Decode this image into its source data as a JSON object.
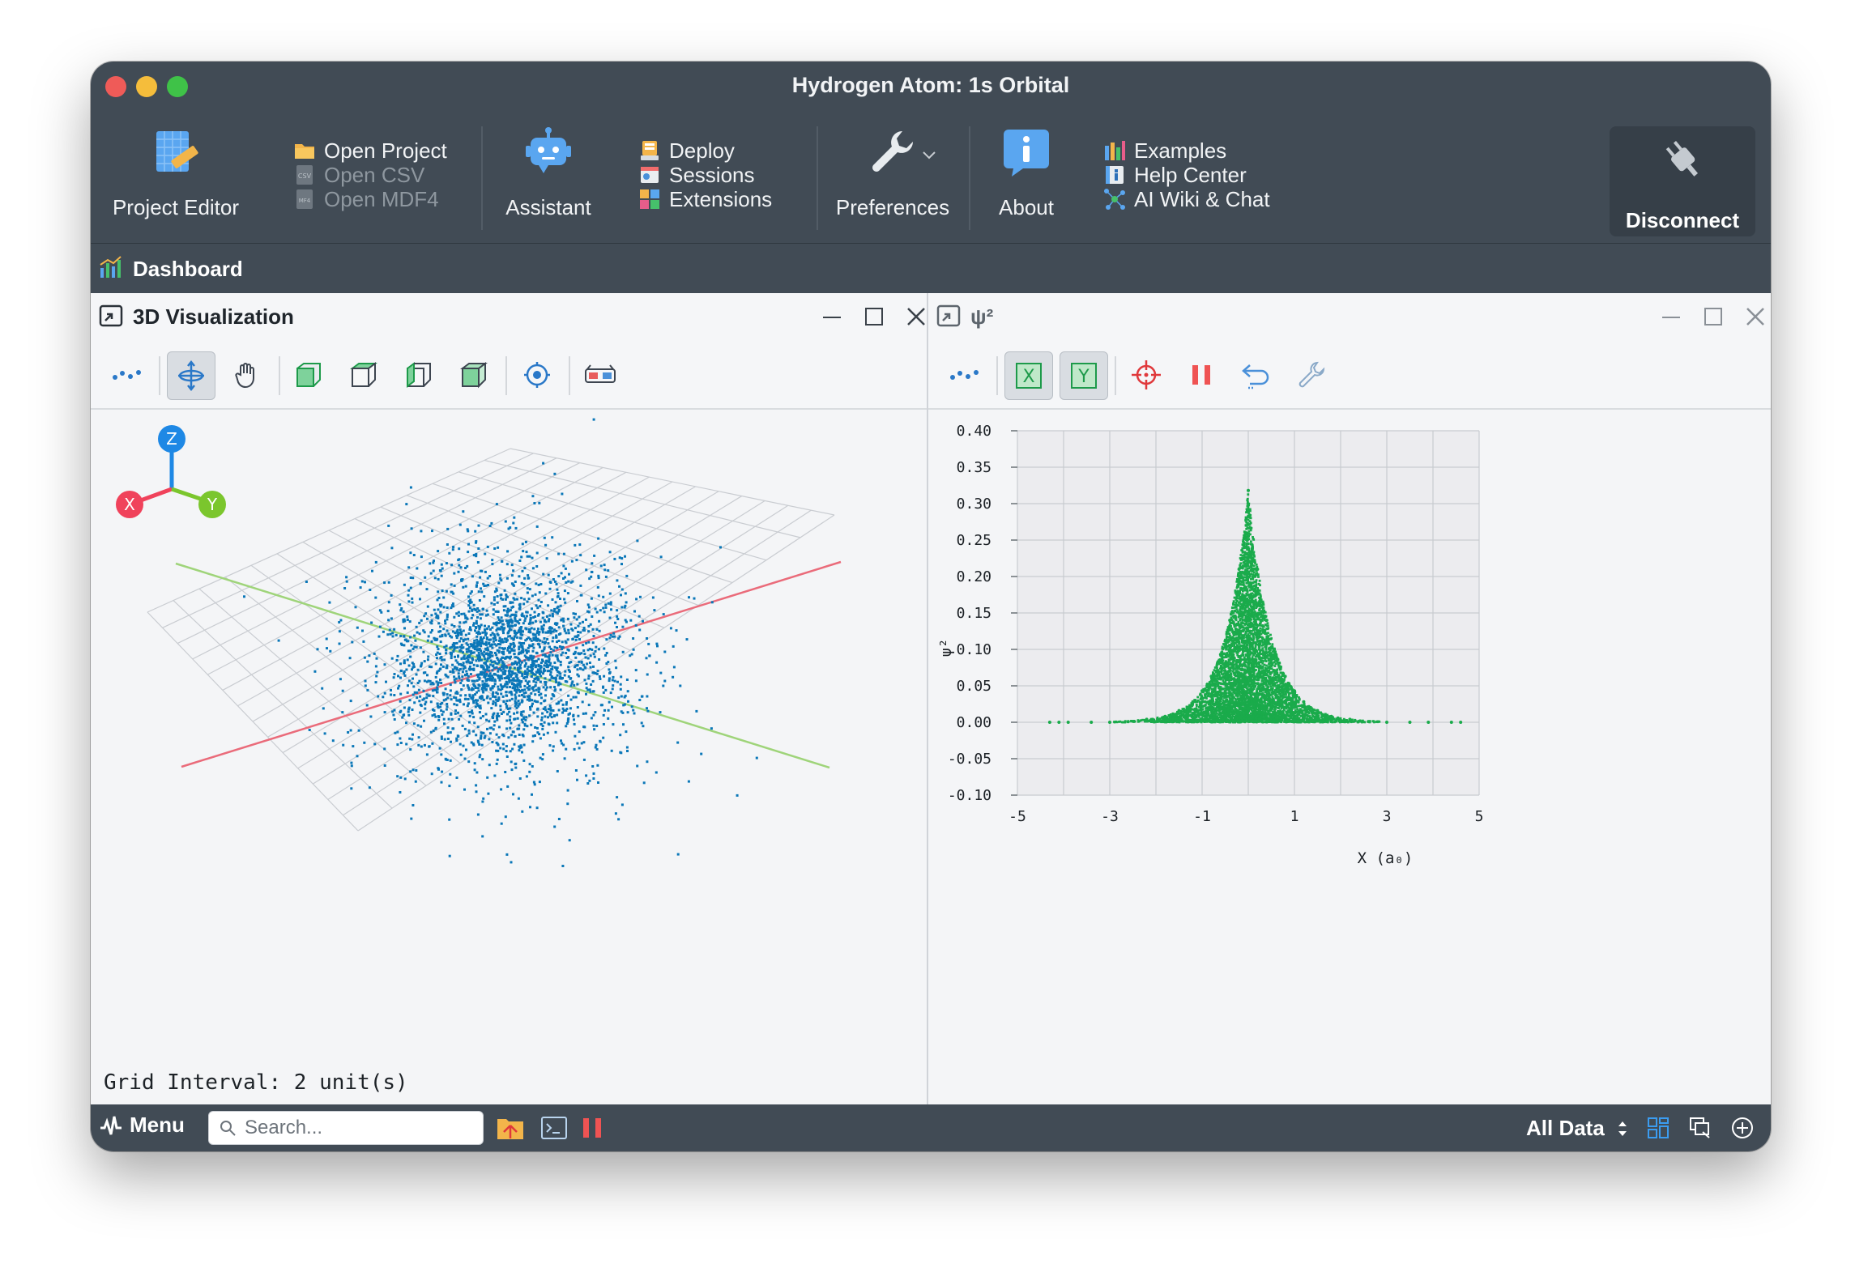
{
  "window": {
    "title": "Hydrogen Atom: 1s Orbital"
  },
  "ribbon": {
    "project_editor": "Project Editor",
    "open_project": "Open Project",
    "open_csv": "Open CSV",
    "open_mdf4": "Open MDF4",
    "assistant": "Assistant",
    "deploy": "Deploy",
    "sessions": "Sessions",
    "extensions": "Extensions",
    "preferences": "Preferences",
    "about": "About",
    "examples": "Examples",
    "help_center": "Help Center",
    "ai_wiki": "AI Wiki & Chat",
    "disconnect": "Disconnect"
  },
  "dashboard": {
    "title": "Dashboard"
  },
  "left_pane": {
    "title": "3D Visualization",
    "grid_interval": "Grid Interval: 2 unit(s)",
    "axes": {
      "z": "Z",
      "x": "X",
      "y": "Y"
    },
    "colors": {
      "points": "#0a77b8",
      "x_axis": "#ea6b7a",
      "y_axis": "#9fd47a"
    }
  },
  "right_pane": {
    "title": "ψ²",
    "toolbar": {
      "x_toggle": "X",
      "y_toggle": "Y"
    }
  },
  "chart_data": {
    "type": "scatter",
    "title": "",
    "xlabel": "X (a₀)",
    "ylabel": "ψ²",
    "xlim": [
      -5,
      5
    ],
    "ylim": [
      -0.1,
      0.4
    ],
    "x_ticks": [
      "-5",
      "-3",
      "-1",
      "1",
      "3",
      "5"
    ],
    "y_ticks": [
      "0.40",
      "0.35",
      "0.30",
      "0.25",
      "0.20",
      "0.15",
      "0.10",
      "0.05",
      "0.00",
      "-0.05",
      "-0.10"
    ],
    "grid": true,
    "color": "#1aab4b",
    "series": [
      {
        "x": [
          -4.3,
          -4.1,
          -3.9,
          -3.4,
          -3.0,
          -2.6,
          -2.2,
          -1.8,
          -1.5,
          -1.2,
          -1.0,
          -0.8,
          -0.6,
          -0.4,
          -0.2,
          0.0,
          0.2,
          0.4,
          0.6,
          0.8,
          1.0,
          1.2,
          1.5,
          1.8,
          2.2,
          2.6,
          3.0,
          3.5,
          3.9,
          4.4,
          4.6
        ],
        "y": [
          0.0,
          0.0,
          0.0,
          0.0,
          0.0,
          0.001,
          0.004,
          0.008,
          0.016,
          0.028,
          0.043,
          0.063,
          0.093,
          0.14,
          0.21,
          0.318,
          0.21,
          0.14,
          0.093,
          0.063,
          0.043,
          0.028,
          0.016,
          0.008,
          0.004,
          0.001,
          0.0,
          0.0,
          0.0,
          0.0,
          0.0
        ]
      }
    ]
  },
  "statusbar": {
    "menu": "Menu",
    "search_placeholder": "Search...",
    "data_filter": "All Data"
  }
}
